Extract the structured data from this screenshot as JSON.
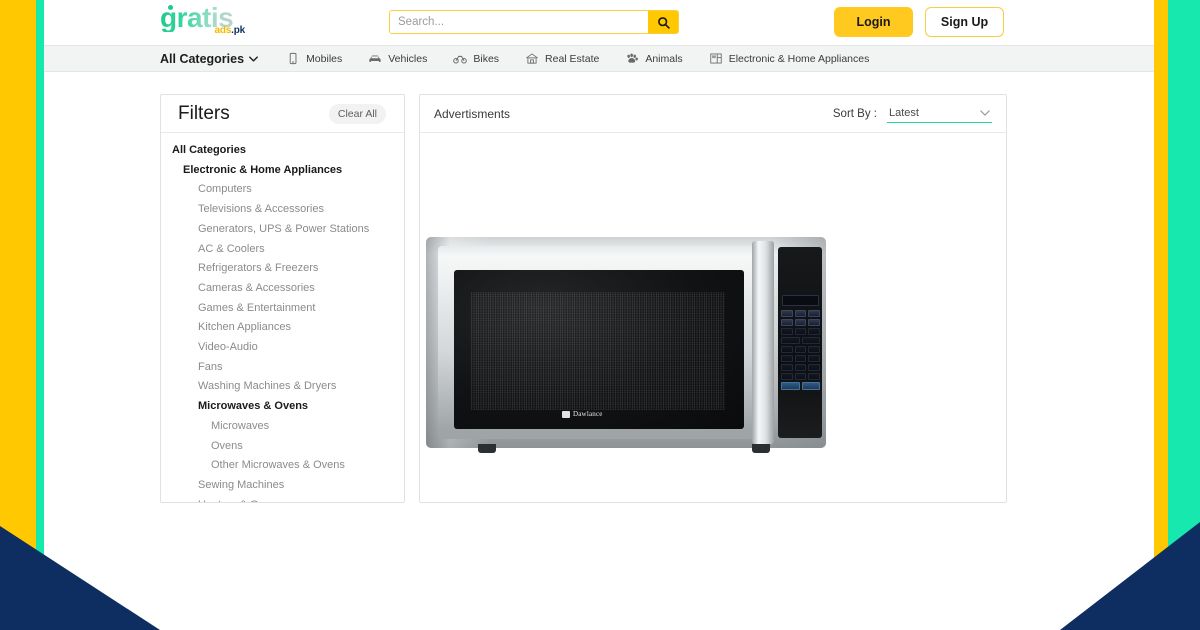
{
  "theme": {
    "yellow": "#FFC800",
    "teal": "#17E8AE",
    "navy": "#0E2D61",
    "accent_green": "#25D6A5",
    "nav_bg": "#F2F4F3"
  },
  "header": {
    "logo": {
      "word": "gratis",
      "sub_ads": "ads",
      "sub_pk": ".pk"
    },
    "search": {
      "value": "",
      "placeholder": "Search...",
      "button_icon": "search-icon"
    },
    "login_label": "Login",
    "signup_label": "Sign Up"
  },
  "nav": {
    "all_categories_label": "All Categories",
    "items": [
      {
        "label": "Mobiles",
        "icon": "mobile-icon"
      },
      {
        "label": "Vehicles",
        "icon": "car-icon"
      },
      {
        "label": "Bikes",
        "icon": "bike-icon"
      },
      {
        "label": "Real Estate",
        "icon": "house-icon"
      },
      {
        "label": "Animals",
        "icon": "paw-icon"
      },
      {
        "label": "Electronic & Home Appliances",
        "icon": "appliance-icon"
      }
    ]
  },
  "filters": {
    "title": "Filters",
    "clear_all_label": "Clear All",
    "categories": [
      {
        "label": "All Categories",
        "level": 0,
        "selected": false
      },
      {
        "label": "Electronic & Home Appliances",
        "level": 1,
        "selected": false
      },
      {
        "label": "Computers",
        "level": 2,
        "selected": false
      },
      {
        "label": "Televisions & Accessories",
        "level": 2,
        "selected": false
      },
      {
        "label": "Generators, UPS & Power Stations",
        "level": 2,
        "selected": false
      },
      {
        "label": "AC & Coolers",
        "level": 2,
        "selected": false
      },
      {
        "label": "Refrigerators & Freezers",
        "level": 2,
        "selected": false
      },
      {
        "label": "Cameras & Accessories",
        "level": 2,
        "selected": false
      },
      {
        "label": "Games & Entertainment",
        "level": 2,
        "selected": false
      },
      {
        "label": "Kitchen Appliances",
        "level": 2,
        "selected": false
      },
      {
        "label": "Video-Audio",
        "level": 2,
        "selected": false
      },
      {
        "label": "Fans",
        "level": 2,
        "selected": false
      },
      {
        "label": "Washing Machines & Dryers",
        "level": 2,
        "selected": false
      },
      {
        "label": "Microwaves & Ovens",
        "level": 2,
        "selected": true
      },
      {
        "label": "Microwaves",
        "level": 3,
        "selected": false
      },
      {
        "label": "Ovens",
        "level": 3,
        "selected": false
      },
      {
        "label": "Other Microwaves & Ovens",
        "level": 3,
        "selected": false
      },
      {
        "label": "Sewing Machines",
        "level": 2,
        "selected": false
      },
      {
        "label": "Heaters & Geysers",
        "level": 2,
        "selected": false
      }
    ]
  },
  "ads": {
    "title": "Advertisments",
    "sort_label": "Sort By :",
    "sort_value": "Latest",
    "sort_options": [
      "Latest"
    ],
    "listing_image": {
      "name": "microwave-oven-photo",
      "brand_text": "Dawlance",
      "alt": "Dawlance stainless steel microwave oven"
    }
  }
}
